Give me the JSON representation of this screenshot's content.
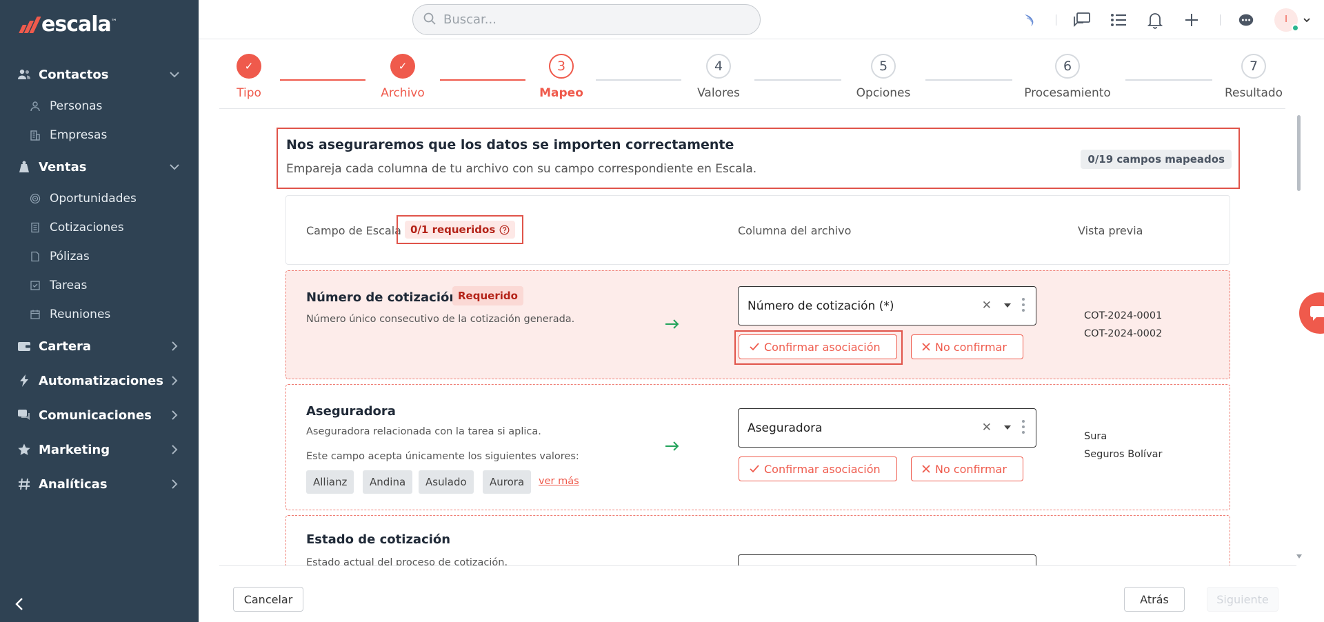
{
  "brand": {
    "name": "escala",
    "tm": "™",
    "accent": "#ef5a4c",
    "sidebar_bg": "#2f4253"
  },
  "sidebar": {
    "items": [
      {
        "label": "Contactos",
        "icon": "contacts-icon",
        "type": "section",
        "chevron": "down"
      },
      {
        "label": "Personas",
        "icon": "person-icon",
        "type": "sub"
      },
      {
        "label": "Empresas",
        "icon": "building-icon",
        "type": "sub"
      },
      {
        "label": "Ventas",
        "icon": "sales-icon",
        "type": "section",
        "chevron": "down"
      },
      {
        "label": "Oportunidades",
        "icon": "target-icon",
        "type": "sub"
      },
      {
        "label": "Cotizaciones",
        "icon": "document-icon",
        "type": "sub"
      },
      {
        "label": "Pólizas",
        "icon": "file-icon",
        "type": "sub"
      },
      {
        "label": "Tareas",
        "icon": "checkbox-icon",
        "type": "sub"
      },
      {
        "label": "Reuniones",
        "icon": "calendar-icon",
        "type": "sub"
      },
      {
        "label": "Cartera",
        "icon": "wallet-icon",
        "type": "section",
        "chevron": "right"
      },
      {
        "label": "Automatizaciones",
        "icon": "bolt-icon",
        "type": "section",
        "chevron": "right"
      },
      {
        "label": "Comunicaciones",
        "icon": "chat-icon",
        "type": "section",
        "chevron": "right"
      },
      {
        "label": "Marketing",
        "icon": "star-icon",
        "type": "section",
        "chevron": "right"
      },
      {
        "label": "Analíticas",
        "icon": "hash-icon",
        "type": "section",
        "chevron": "right"
      }
    ]
  },
  "search": {
    "placeholder": "Buscar..."
  },
  "user": {
    "initial": "I"
  },
  "stepper": {
    "steps": [
      {
        "num": "✓",
        "label": "Tipo",
        "state": "done"
      },
      {
        "num": "✓",
        "label": "Archivo",
        "state": "done"
      },
      {
        "num": "3",
        "label": "Mapeo",
        "state": "current"
      },
      {
        "num": "4",
        "label": "Valores",
        "state": "todo"
      },
      {
        "num": "5",
        "label": "Opciones",
        "state": "todo"
      },
      {
        "num": "6",
        "label": "Procesamiento",
        "state": "todo"
      },
      {
        "num": "7",
        "label": "Resultado",
        "state": "todo"
      }
    ]
  },
  "intro": {
    "title": "Nos aseguraremos que los datos se importen correctamente",
    "subtitle": "Empareja cada columna de tu archivo con su campo correspondiente en Escala.",
    "badge": "0/19 campos mapeados"
  },
  "table_header": {
    "col1": "Campo de Escala",
    "required": "0/1 requeridos",
    "col2": "Columna del archivo",
    "col3": "Vista previa"
  },
  "rows": [
    {
      "name": "Número de cotización",
      "required_tag": "Requerido",
      "description": "Número único consecutivo de la cotización generada.",
      "selected": "Número de cotización (*)",
      "preview": [
        "COT-2024-0001",
        "COT-2024-0002"
      ]
    },
    {
      "name": "Aseguradora",
      "description": "Aseguradora relacionada con la tarea si aplica.",
      "hint": "Este campo acepta únicamente los siguientes valores:",
      "chips": [
        "Allianz",
        "Andina",
        "Asulado",
        "Aurora"
      ],
      "more": "ver más",
      "selected": "Aseguradora",
      "preview": [
        "Sura",
        "Seguros Bolívar"
      ]
    },
    {
      "name": "Estado de cotización",
      "description": "Estado actual del proceso de cotización."
    }
  ],
  "actions": {
    "confirm": "Confirmar asociación",
    "reject": "No confirmar",
    "cancel": "Cancelar",
    "back": "Atrás",
    "next": "Siguiente"
  }
}
